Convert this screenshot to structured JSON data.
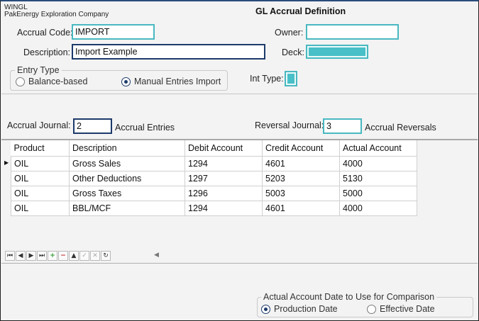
{
  "app": {
    "name": "WINGL",
    "company": "PakEnergy Exploration Company",
    "title": "GL Accrual Definition"
  },
  "form": {
    "accrual_code_label": "Accrual Code:",
    "accrual_code": "IMPORT",
    "description_label": "Description:",
    "description": "Import Example",
    "owner_label": "Owner:",
    "owner": "",
    "deck_label": "Deck:",
    "int_type_label": "Int Type:"
  },
  "entry_type": {
    "legend": "Entry Type",
    "options": [
      "Balance-based",
      "Manual Entries Import"
    ],
    "selected": "Manual Entries Import"
  },
  "journals": {
    "accrual_label": "Accrual Journal:",
    "accrual_value": "2",
    "accrual_desc": "Accrual Entries",
    "reversal_label": "Reversal Journal:",
    "reversal_value": "3",
    "reversal_desc": "Accrual Reversals"
  },
  "grid": {
    "columns": [
      "Product",
      "Description",
      "Debit Account",
      "Credit Account",
      "Actual Account"
    ],
    "rows": [
      [
        "OIL",
        "Gross Sales",
        "1294",
        "4601",
        "4000"
      ],
      [
        "OIL",
        "Other Deductions",
        "1297",
        "5203",
        "5130"
      ],
      [
        "OIL",
        "Gross Taxes",
        "1296",
        "5003",
        "5000"
      ],
      [
        "OIL",
        "BBL/MCF",
        "1294",
        "4601",
        "4000"
      ]
    ],
    "current_row_indicator": "▶"
  },
  "navigator": {
    "buttons": [
      {
        "icon": "first-record-icon",
        "glyph": "⏮"
      },
      {
        "icon": "previous-record-icon",
        "glyph": "◀"
      },
      {
        "icon": "next-record-icon",
        "glyph": "▶"
      },
      {
        "icon": "last-record-icon",
        "glyph": "⏭"
      },
      {
        "icon": "add-record-icon",
        "glyph": "+"
      },
      {
        "icon": "delete-record-icon",
        "glyph": "−"
      },
      {
        "icon": "edit-record-icon",
        "glyph": "▲"
      },
      {
        "icon": "post-edit-icon",
        "glyph": "✓"
      },
      {
        "icon": "cancel-edit-icon",
        "glyph": "✕"
      },
      {
        "icon": "refresh-icon",
        "glyph": "↻"
      }
    ]
  },
  "comparison": {
    "legend": "Actual Account Date to Use for Comparison",
    "options": [
      "Production Date",
      "Effective Date"
    ],
    "selected": "Production Date"
  }
}
